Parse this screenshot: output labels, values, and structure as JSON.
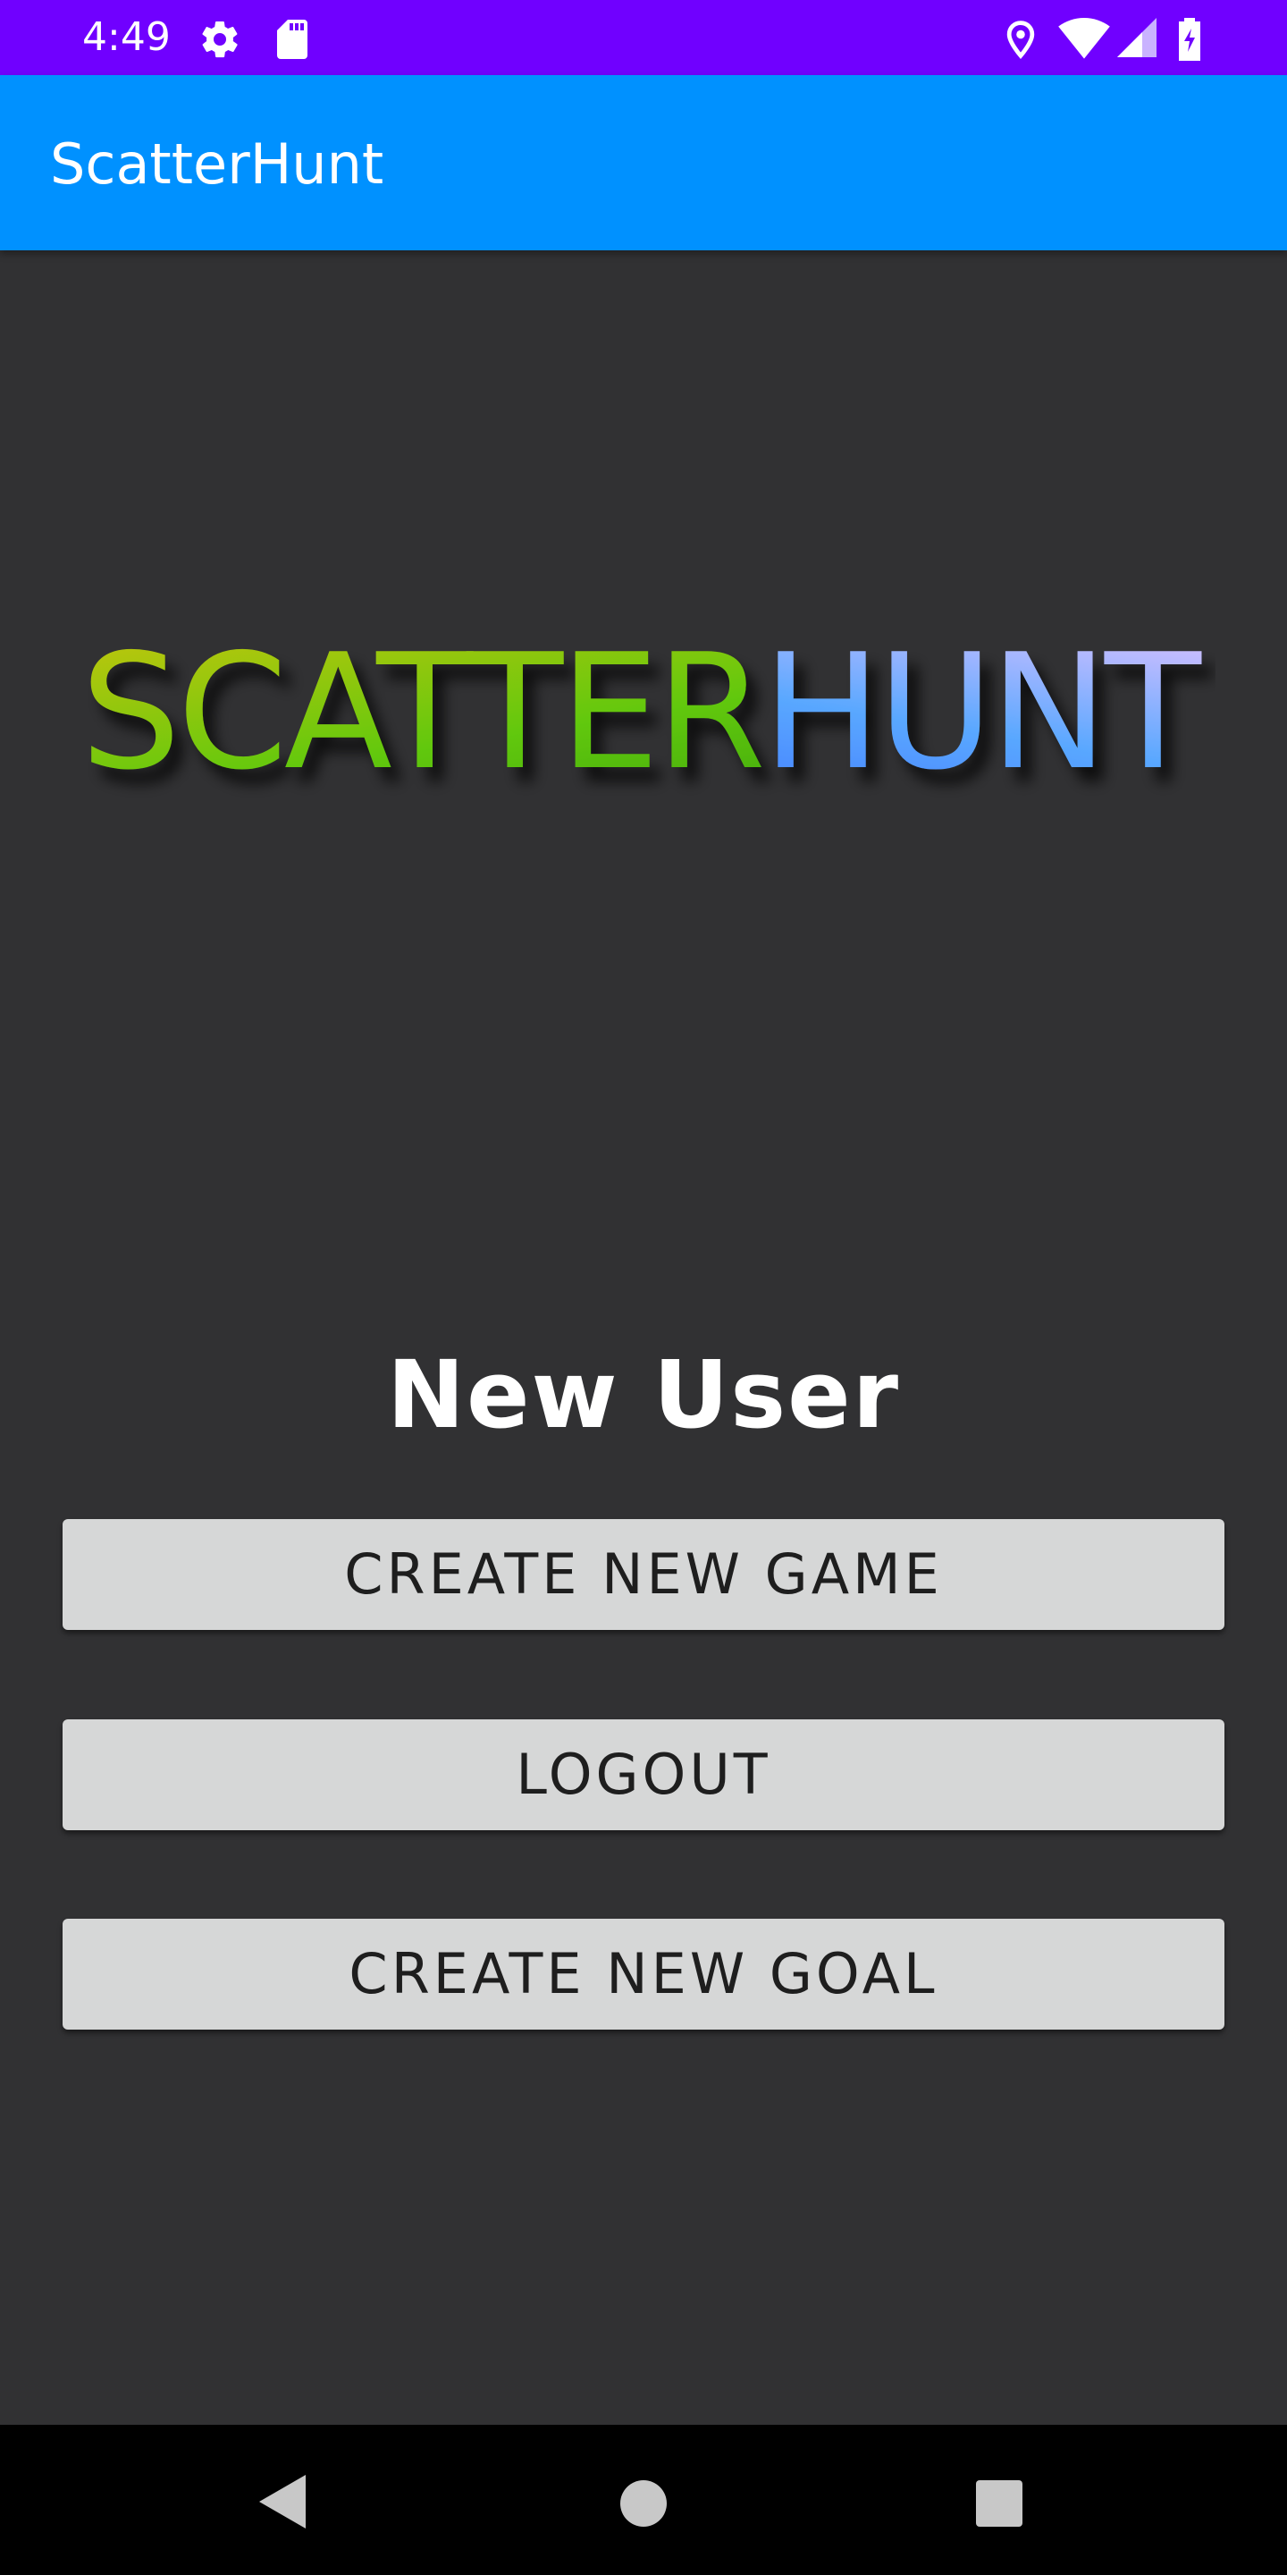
{
  "status_bar": {
    "time": "4:49",
    "icons": [
      "gear-icon",
      "sd-card-icon",
      "location-icon",
      "wifi-icon",
      "cell-signal-icon",
      "battery-charging-icon"
    ]
  },
  "app_bar": {
    "title": "ScatterHunt"
  },
  "logo": {
    "part1": "SCATTER",
    "part2": "HUNT",
    "colors": {
      "part1_start": "#b9c20a",
      "part1_end": "#3fbf0a",
      "part2_start": "#3a6bff",
      "part2_end": "#d9b7ff"
    }
  },
  "main": {
    "heading": "New User",
    "buttons": {
      "create_game": "CREATE NEW GAME",
      "logout": "LOGOUT",
      "create_goal": "CREATE NEW GOAL"
    }
  },
  "nav_bar": {
    "icons": [
      "back-icon",
      "home-icon",
      "recents-icon"
    ]
  },
  "colors": {
    "status_bar": "#7000ff",
    "app_bar": "#0091ff",
    "background": "#313133",
    "button": "#d6d7d7"
  }
}
